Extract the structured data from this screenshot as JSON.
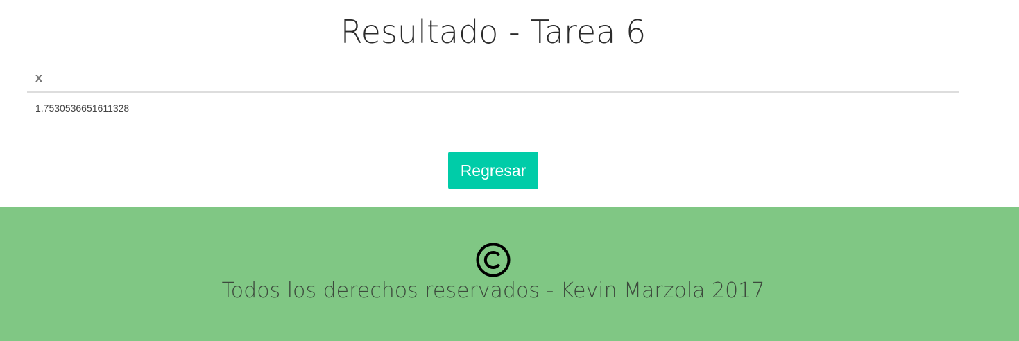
{
  "page": {
    "title": "Resultado - Tarea 6"
  },
  "results": {
    "columns": [
      "x"
    ],
    "rows": [
      [
        "1.7530536651611328"
      ]
    ]
  },
  "actions": {
    "back_label": "Regresar"
  },
  "footer": {
    "icon": "copyright-icon",
    "text": "Todos los derechos reservados - Kevin Marzola 2017"
  },
  "colors": {
    "button": "#00cca8",
    "footer_background": "#80c784"
  }
}
